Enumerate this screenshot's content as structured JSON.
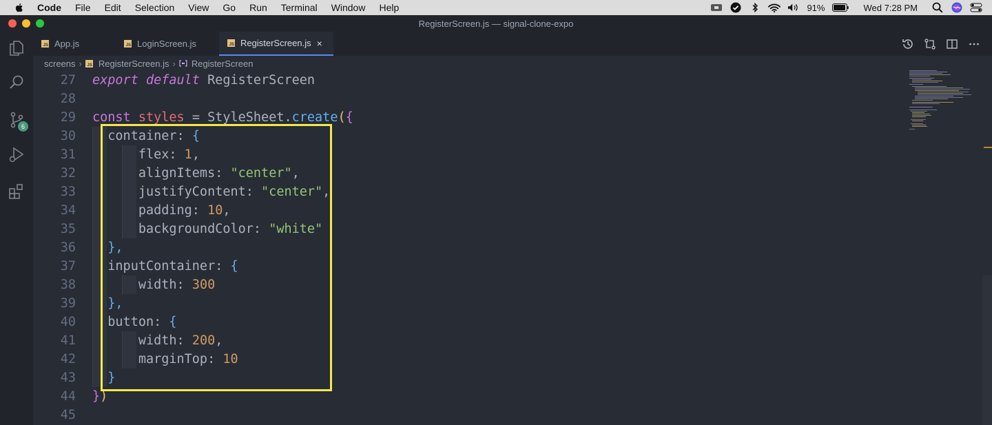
{
  "menubar": {
    "app_name": "Code",
    "items": [
      "File",
      "Edit",
      "Selection",
      "View",
      "Go",
      "Run",
      "Terminal",
      "Window",
      "Help"
    ],
    "battery": "91%",
    "clock": "Wed 7:28 PM"
  },
  "window": {
    "title": "RegisterScreen.js — signal-clone-expo"
  },
  "activitybar": {
    "source_control_badge": "6"
  },
  "tabs": [
    {
      "label": "App.js",
      "icon_text": "JS"
    },
    {
      "label": "LoginScreen.js",
      "icon_text": "JS"
    },
    {
      "label": "RegisterScreen.js",
      "icon_text": "JS",
      "close": "×"
    }
  ],
  "breadcrumb": {
    "folder": "screens",
    "file": "RegisterScreen.js",
    "symbol": "RegisterScreen",
    "sep": "›"
  },
  "editor": {
    "line_numbers": [
      "27",
      "28",
      "29",
      "30",
      "31",
      "32",
      "33",
      "34",
      "35",
      "36",
      "37",
      "38",
      "39",
      "40",
      "41",
      "42",
      "43",
      "44",
      "45"
    ],
    "tokens": {
      "l27": [
        "export",
        "default",
        "RegisterScreen"
      ],
      "l29": [
        "const",
        "styles",
        "=",
        "StyleSheet",
        ".",
        "create",
        "(",
        "{"
      ],
      "l30": [
        "container",
        ":",
        "{"
      ],
      "l31": [
        "flex",
        ":",
        "1",
        ","
      ],
      "l32": [
        "alignItems",
        ":",
        "\"center\"",
        ","
      ],
      "l33": [
        "justifyContent",
        ":",
        "\"center\"",
        ","
      ],
      "l34": [
        "padding",
        ":",
        "10",
        ","
      ],
      "l35": [
        "backgroundColor",
        ":",
        "\"white\""
      ],
      "l36": [
        "},"
      ],
      "l37": [
        "inputContainer",
        ":",
        "{"
      ],
      "l38": [
        "width",
        ":",
        "300"
      ],
      "l39": [
        "},"
      ],
      "l40": [
        "button",
        ":",
        "{"
      ],
      "l41": [
        "width",
        ":",
        "200",
        ","
      ],
      "l42": [
        "marginTop",
        ":",
        "10"
      ],
      "l43": [
        "}"
      ],
      "l44": [
        "}",
        ")"
      ]
    }
  },
  "colors": {
    "editor_bg": "#282c34",
    "highlight_border": "#f4e94a",
    "keyword": "#c678dd",
    "string": "#98c379",
    "number": "#d19a66",
    "function": "#61afef",
    "variable": "#e06c75"
  },
  "icons": [
    "apple-icon",
    "files-icon",
    "search-icon",
    "source-control-icon",
    "run-debug-icon",
    "extensions-icon",
    "timeline-icon",
    "compare-icon",
    "split-editor-icon",
    "more-icon",
    "wifi-icon",
    "bluetooth-icon",
    "volume-icon",
    "battery-icon",
    "spotlight-icon",
    "siri-icon",
    "control-center-icon"
  ]
}
